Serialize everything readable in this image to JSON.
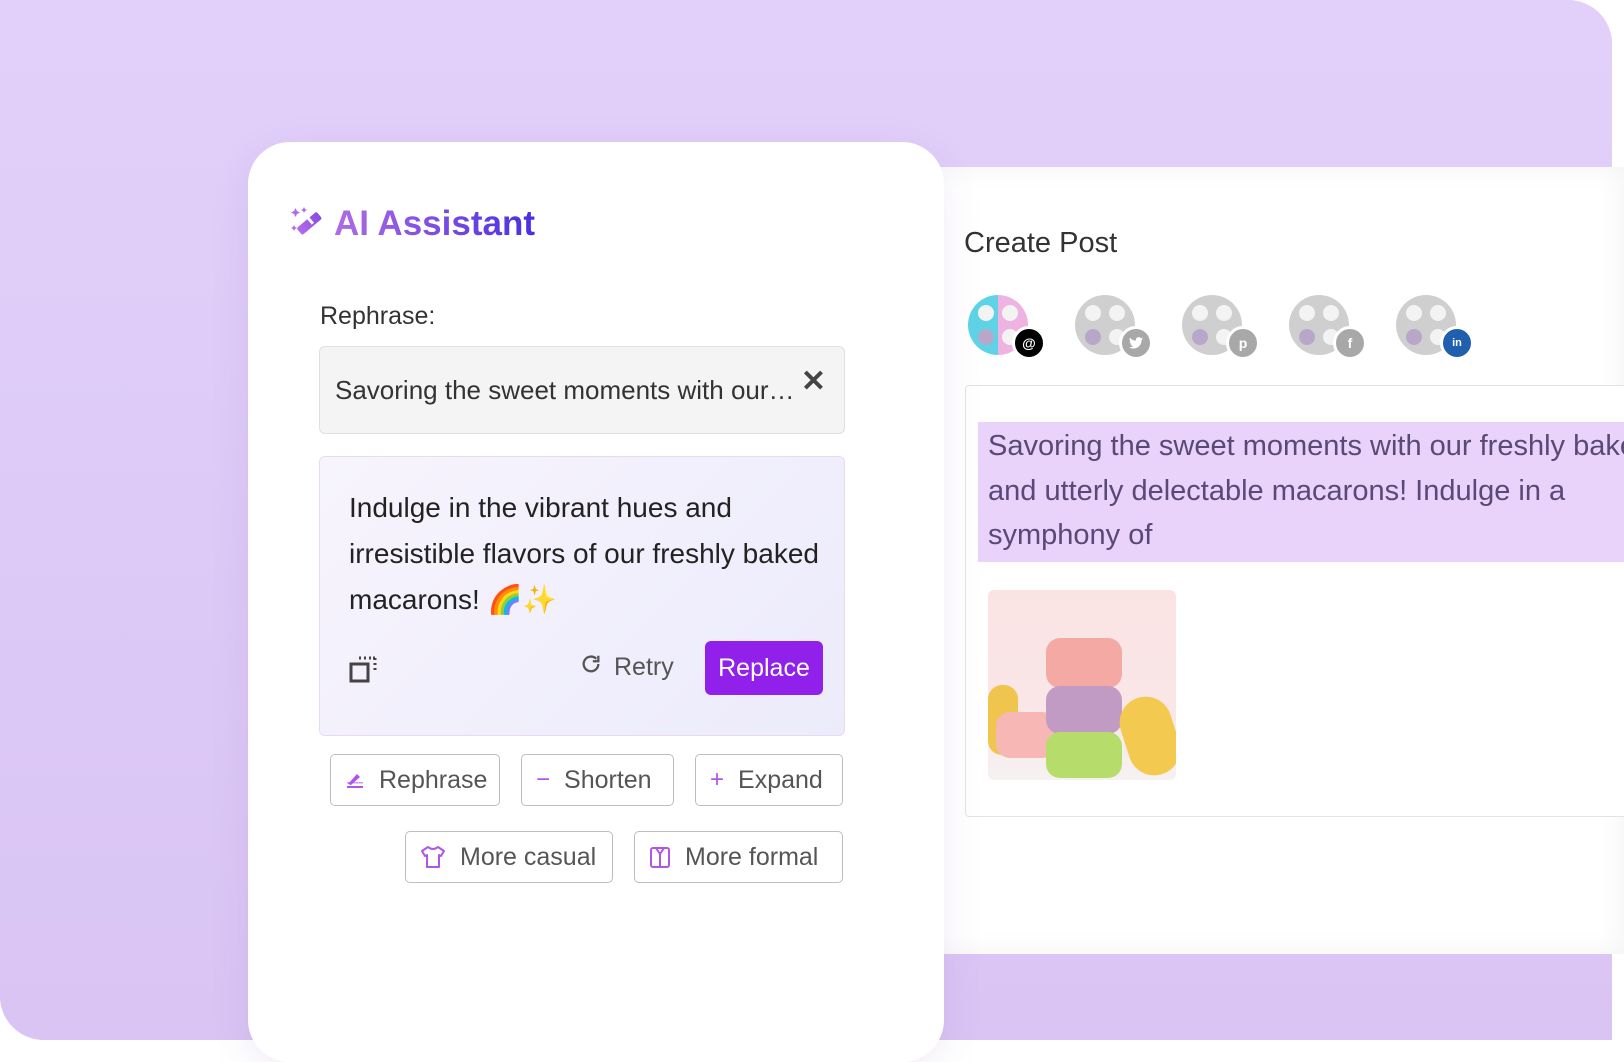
{
  "colors": {
    "background": "#dcc9f6",
    "accent": "#9120ea",
    "highlight": "#e9d3fb"
  },
  "ai_assistant": {
    "icon": "magic-wand-icon",
    "title": "AI Assistant",
    "rephrase_label": "Rephrase:",
    "input": {
      "value": "Savoring the sweet moments with our…",
      "clear_icon": "close-icon"
    },
    "result": {
      "text": "Indulge in the vibrant hues and irresistible flavors of our freshly baked macarons! 🌈✨",
      "copy_icon": "copy-icon",
      "retry_label": "Retry",
      "retry_icon": "refresh-icon",
      "replace_label": "Replace"
    },
    "actions": [
      {
        "label": "Rephrase",
        "icon": "pen-icon"
      },
      {
        "label": "Shorten",
        "icon": "minus-icon"
      },
      {
        "label": "Expand",
        "icon": "plus-icon"
      },
      {
        "label": "More casual",
        "icon": "tshirt-icon"
      },
      {
        "label": "More formal",
        "icon": "suit-icon"
      }
    ]
  },
  "create_post": {
    "title": "Create Post",
    "accounts": [
      {
        "network": "threads",
        "badge": "@",
        "selected": true
      },
      {
        "network": "twitter",
        "badge": "t",
        "selected": false
      },
      {
        "network": "pinterest",
        "badge": "p",
        "selected": false
      },
      {
        "network": "facebook",
        "badge": "f",
        "selected": false
      },
      {
        "network": "linkedin",
        "badge": "in",
        "selected": false
      }
    ],
    "post_text": "Savoring the sweet moments with our freshly baked and utterly delectable macarons! Indulge in a symphony of",
    "image_alt": "Stack of colorful macarons"
  }
}
